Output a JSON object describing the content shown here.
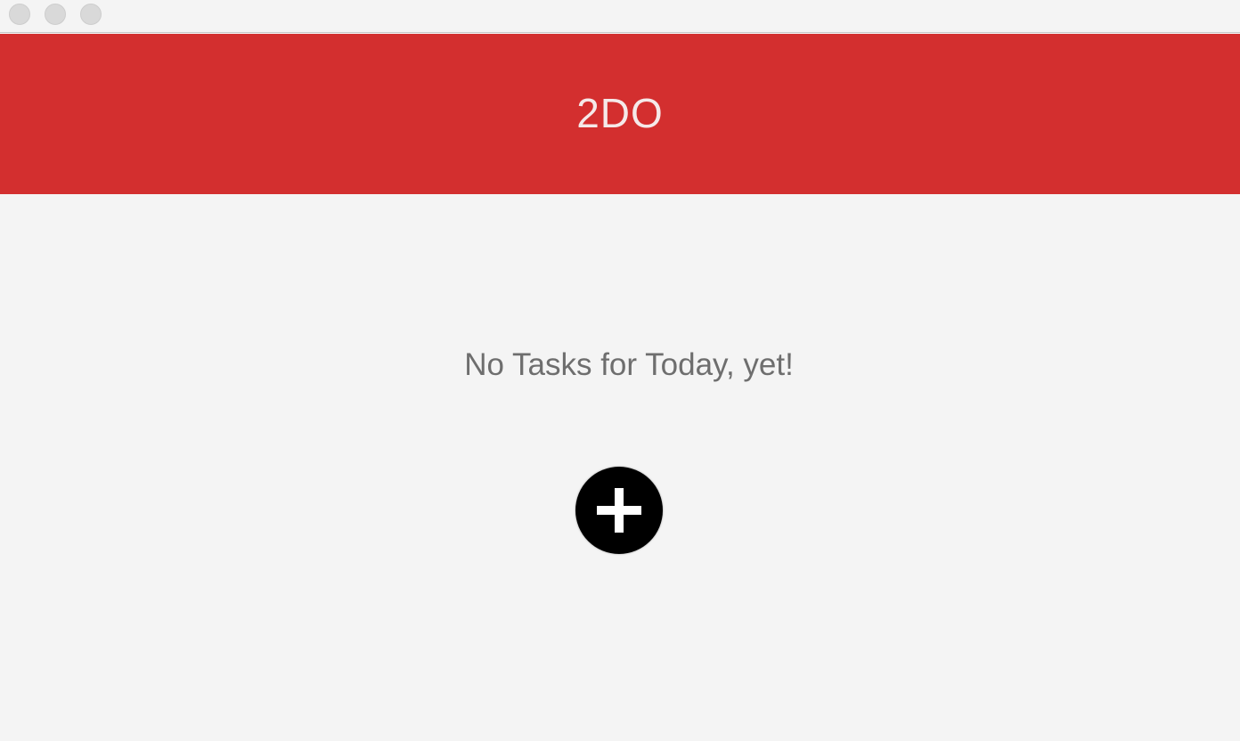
{
  "app": {
    "title": "2DO",
    "header_color": "#d32f2f"
  },
  "window_controls": {
    "close_icon": "circle",
    "minimize_icon": "circle",
    "zoom_icon": "circle"
  },
  "main": {
    "empty_message": "No Tasks for Today, yet!",
    "add_button_icon": "plus-icon"
  }
}
